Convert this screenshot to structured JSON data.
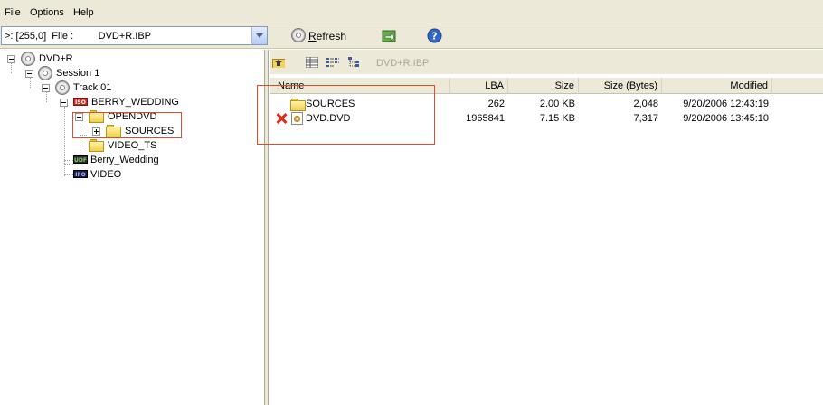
{
  "menu": [
    "File",
    "Options",
    "Help"
  ],
  "toolbar": {
    "path_value": ">: [255,0]  File :         DVD+R.IBP",
    "refresh_prefix": "",
    "refresh_underlined": "R",
    "refresh_rest": "efresh"
  },
  "tree": {
    "root": "DVD+R",
    "session": "Session 1",
    "track": "Track 01",
    "berry_wedding_iso": "BERRY_WEDDING",
    "opendvd": "OPENDVD",
    "sources": "SOURCES",
    "video_ts": "VIDEO_TS",
    "berry_wedding_udf": "Berry_Wedding",
    "video_ifo": "VIDEO"
  },
  "icons": {
    "iso_tag": "ISO",
    "udf_tag": "UDF",
    "ifo_tag": "IFO"
  },
  "right_toolbar": {
    "path": "DVD+R.IBP"
  },
  "columns": {
    "name": "Name",
    "lba": "LBA",
    "size": "Size",
    "size_bytes": "Size (Bytes)",
    "modified": "Modified"
  },
  "files": [
    {
      "name": "SOURCES",
      "lba": "262",
      "size": "2.00 KB",
      "size_bytes": "2,048",
      "modified": "9/20/2006 12:43:19"
    },
    {
      "name": "DVD.DVD",
      "lba": "1965841",
      "size": "7.15 KB",
      "size_bytes": "7,317",
      "modified": "9/20/2006 13:45:10"
    }
  ],
  "colors": {
    "highlight_box": "#e04b2a",
    "chrome": "#ece9d8"
  }
}
